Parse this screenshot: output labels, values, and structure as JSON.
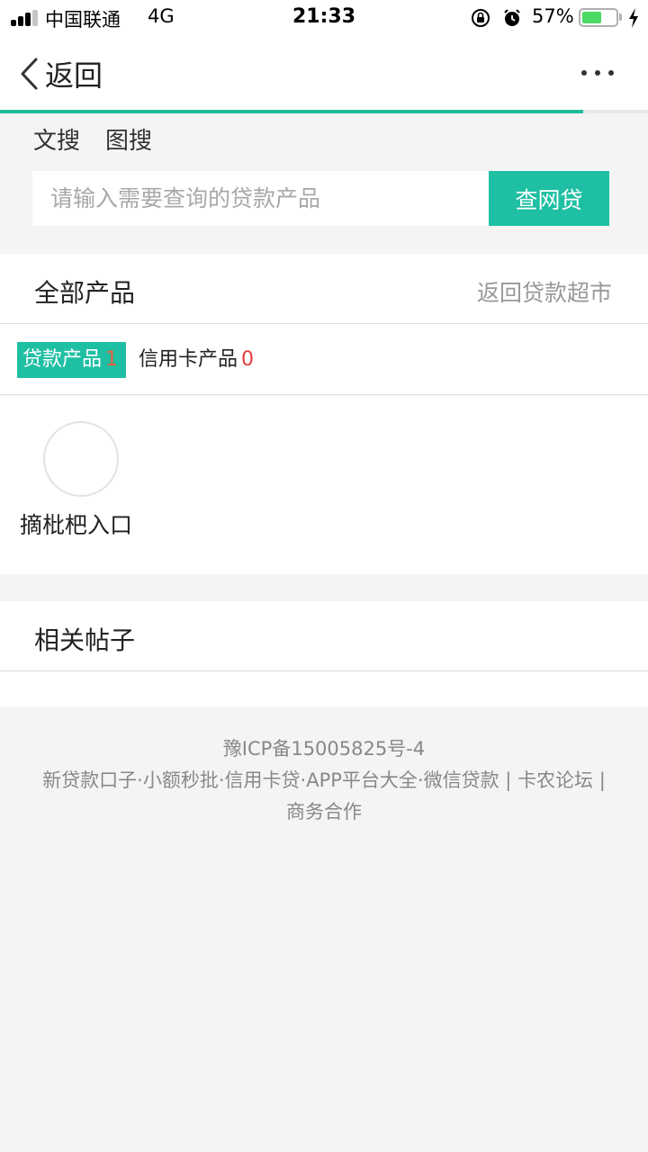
{
  "status_bar": {
    "carrier": "中国联通",
    "network": "4G",
    "time": "21:33",
    "battery_percent": "57%",
    "battery_level": 0.57,
    "icons": [
      "signal-icon",
      "rotation-lock-icon",
      "alarm-icon",
      "battery-icon",
      "charging-icon"
    ]
  },
  "nav": {
    "back_label": "返回",
    "more_icon": "more-dots-icon",
    "page_load_progress": 0.9
  },
  "search": {
    "tabs": [
      "文搜",
      "图搜"
    ],
    "placeholder": "请输入需要查询的贷款产品",
    "button_label": "查网贷"
  },
  "products": {
    "title": "全部产品",
    "link_label": "返回贷款超市",
    "filters": [
      {
        "label": "贷款产品",
        "count": "1"
      },
      {
        "label": "信用卡产品",
        "count": "0"
      }
    ],
    "items": [
      {
        "name": "摘枇杷入口"
      }
    ]
  },
  "posts": {
    "title": "相关帖子"
  },
  "footer": {
    "icp": "豫ICP备15005825号-4",
    "links": [
      "新贷款口子",
      "小额秒批",
      "信用卡贷",
      "APP平台大全",
      "微信贷款",
      "卡农论坛",
      "商务合作"
    ],
    "dot": "·",
    "pipe": "|"
  },
  "colors": {
    "accent": "#1fbfa3",
    "count_red": "#e23b3b",
    "battery_green": "#4cd964"
  }
}
